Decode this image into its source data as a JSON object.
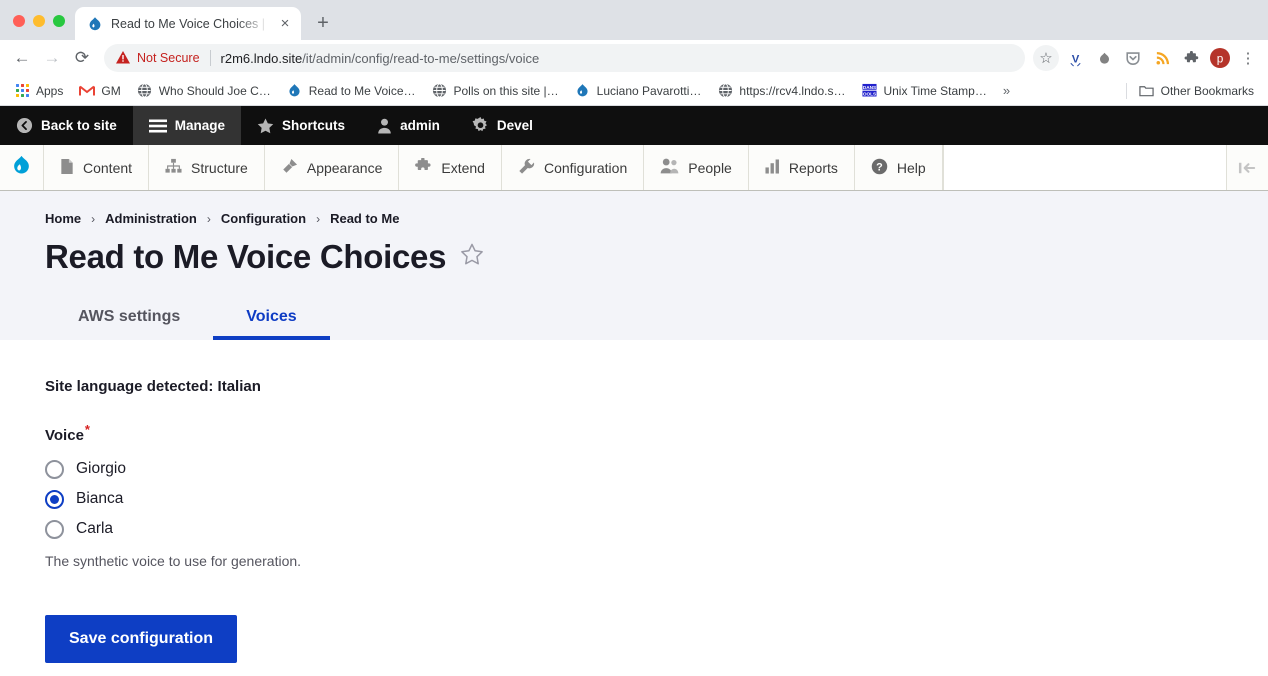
{
  "browser": {
    "tab": {
      "title": "Read to Me Voice Choices | Dru",
      "favicon": "drupal-drop-icon",
      "close": "×"
    },
    "newtab_label": "+",
    "nav": {
      "back": "←",
      "forward": "→",
      "reload": "⟳"
    },
    "omnibox": {
      "warning_icon": "not-secure-warning-icon",
      "security_label": "Not Secure",
      "url_host": "r2m6.lndo.site",
      "url_path": "/it/admin/config/read-to-me/settings/voice"
    },
    "toolbar_icons": [
      {
        "name": "bookmark-star-icon",
        "glyph": "☆"
      },
      {
        "name": "vimeo-v-extension-icon",
        "glyph": "V"
      },
      {
        "name": "drupal-extension-icon",
        "glyph": "●"
      },
      {
        "name": "pocket-extension-icon",
        "glyph": "▽"
      },
      {
        "name": "rss-feed-extension-icon",
        "glyph": "◠"
      },
      {
        "name": "extensions-puzzle-icon",
        "glyph": "❖"
      },
      {
        "name": "profile-avatar-icon",
        "glyph": "p"
      },
      {
        "name": "chrome-menu-kebab-icon",
        "glyph": "⋮"
      }
    ],
    "bookmarks": [
      {
        "label": "Apps",
        "icon": "apps-grid-icon"
      },
      {
        "label": "GM",
        "icon": "gmail-icon"
      },
      {
        "label": "Who Should Joe C…",
        "icon": "globe-icon"
      },
      {
        "label": "Read to Me Voice…",
        "icon": "drupal-drop-icon"
      },
      {
        "label": "Polls on this site |…",
        "icon": "globe-icon"
      },
      {
        "label": "Luciano Pavarotti…",
        "icon": "drupal-drop-icon"
      },
      {
        "label": "https://rcv4.lndo.s…",
        "icon": "globe-icon"
      },
      {
        "label": "Unix Time Stamp…",
        "icon": "dans-tools-icon"
      }
    ],
    "bookmarks_overflow": "»",
    "other_bookmarks": {
      "label": "Other Bookmarks",
      "icon": "folder-icon"
    }
  },
  "admin_toolbar": {
    "items": [
      {
        "label": "Back to site",
        "icon": "back-arrow-circle-icon",
        "active": false
      },
      {
        "label": "Manage",
        "icon": "hamburger-icon",
        "active": true
      },
      {
        "label": "Shortcuts",
        "icon": "star-icon",
        "active": false
      },
      {
        "label": "admin",
        "icon": "person-icon",
        "active": false
      },
      {
        "label": "Devel",
        "icon": "gear-icon",
        "active": false
      }
    ]
  },
  "admin_menu": {
    "logo": "drupal-logo-icon",
    "items": [
      {
        "label": "Content",
        "icon": "document-icon"
      },
      {
        "label": "Structure",
        "icon": "sitemap-icon"
      },
      {
        "label": "Appearance",
        "icon": "paintbrush-icon"
      },
      {
        "label": "Extend",
        "icon": "puzzle-piece-icon"
      },
      {
        "label": "Configuration",
        "icon": "wrench-icon"
      },
      {
        "label": "People",
        "icon": "people-icon"
      },
      {
        "label": "Reports",
        "icon": "bar-chart-icon"
      },
      {
        "label": "Help",
        "icon": "question-circle-icon"
      }
    ],
    "collapse_icon": "collapse-left-icon"
  },
  "page": {
    "breadcrumb": [
      "Home",
      "Administration",
      "Configuration",
      "Read to Me"
    ],
    "breadcrumb_separator": "›",
    "title": "Read to Me Voice Choices",
    "title_star_icon": "favorite-star-outline-icon",
    "tabs": [
      {
        "label": "AWS settings",
        "active": false
      },
      {
        "label": "Voices",
        "active": true
      }
    ]
  },
  "form": {
    "language_note": "Site language detected: Italian",
    "field_label": "Voice",
    "required_marker": "*",
    "options": [
      {
        "label": "Giorgio",
        "selected": false
      },
      {
        "label": "Bianca",
        "selected": true
      },
      {
        "label": "Carla",
        "selected": false
      }
    ],
    "description": "The synthetic voice to use for generation.",
    "submit_label": "Save configuration"
  },
  "colors": {
    "accent_blue": "#0e3ec4",
    "drupal_cyan": "#00a0d8",
    "not_secure_red": "#c5221f",
    "required_red": "#d72222",
    "header_bg": "#f3f4f9",
    "toolbar_black": "#0f0f0f"
  }
}
